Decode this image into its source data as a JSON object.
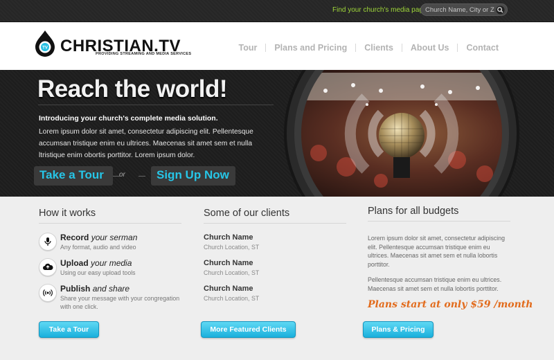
{
  "topbar": {
    "find_label": "Find your church's media page:",
    "search_placeholder": "Church Name, City or Zip",
    "search_icon": "search-icon"
  },
  "header": {
    "logo_text": "CHRISTIAN.TV",
    "logo_tagline": "PROVIDING STREAMING AND MEDIA SERVICES",
    "nav": [
      "Tour",
      "Plans and Pricing",
      "Clients",
      "About Us",
      "Contact"
    ]
  },
  "hero": {
    "title": "Reach the world!",
    "intro": "Introducing your church's complete media solution.",
    "body": "Lorem ipsum dolor sit amet, consectetur adipiscing elit. Pellentesque accumsan tristique enim eu ultrices. Maecenas sit amet sem et nulla ltristique enim obortis porttitor. Lorem ipsum dolor.",
    "cta_tour": "Take a Tour",
    "cta_or": "or",
    "cta_signup": "Sign Up Now"
  },
  "how_it_works": {
    "title": "How it works",
    "steps": [
      {
        "head_bold": "Record",
        "head_italic": "your serman",
        "desc": "Any format, audio and video",
        "icon": "microphone-icon"
      },
      {
        "head_bold": "Upload",
        "head_italic": "your media",
        "desc": "Using our easy upload tools",
        "icon": "cloud-upload-icon"
      },
      {
        "head_bold": "Publish",
        "head_italic": "and share",
        "desc": "Share your message with your congregation with one click.",
        "icon": "broadcast-icon"
      }
    ],
    "button": "Take a Tour"
  },
  "clients": {
    "title": "Some of our clients",
    "items": [
      {
        "name": "Church Name",
        "location": "Church Location, ST"
      },
      {
        "name": "Church Name",
        "location": "Church Location, ST"
      },
      {
        "name": "Church Name",
        "location": "Church Location, ST"
      }
    ],
    "button": "More Featured Clients"
  },
  "plans": {
    "title": "Plans for all budgets",
    "para1": "Lorem ipsum dolor sit amet, consectetur adipiscing elit. Pellentesque accumsan tristique enim eu ultrices. Maecenas sit amet sem et nulla lobortis porttitor.",
    "para2": "Pellentesque accumsan tristique enim eu ultrices. Maecenas sit amet sem et nulla lobortis porttitor.",
    "price_line": "Plans start at only $59 /month",
    "button": "Plans & Pricing"
  },
  "colors": {
    "accent_cyan": "#26c6e8",
    "accent_green": "#9fd63a",
    "price_orange": "#e26b1c"
  }
}
